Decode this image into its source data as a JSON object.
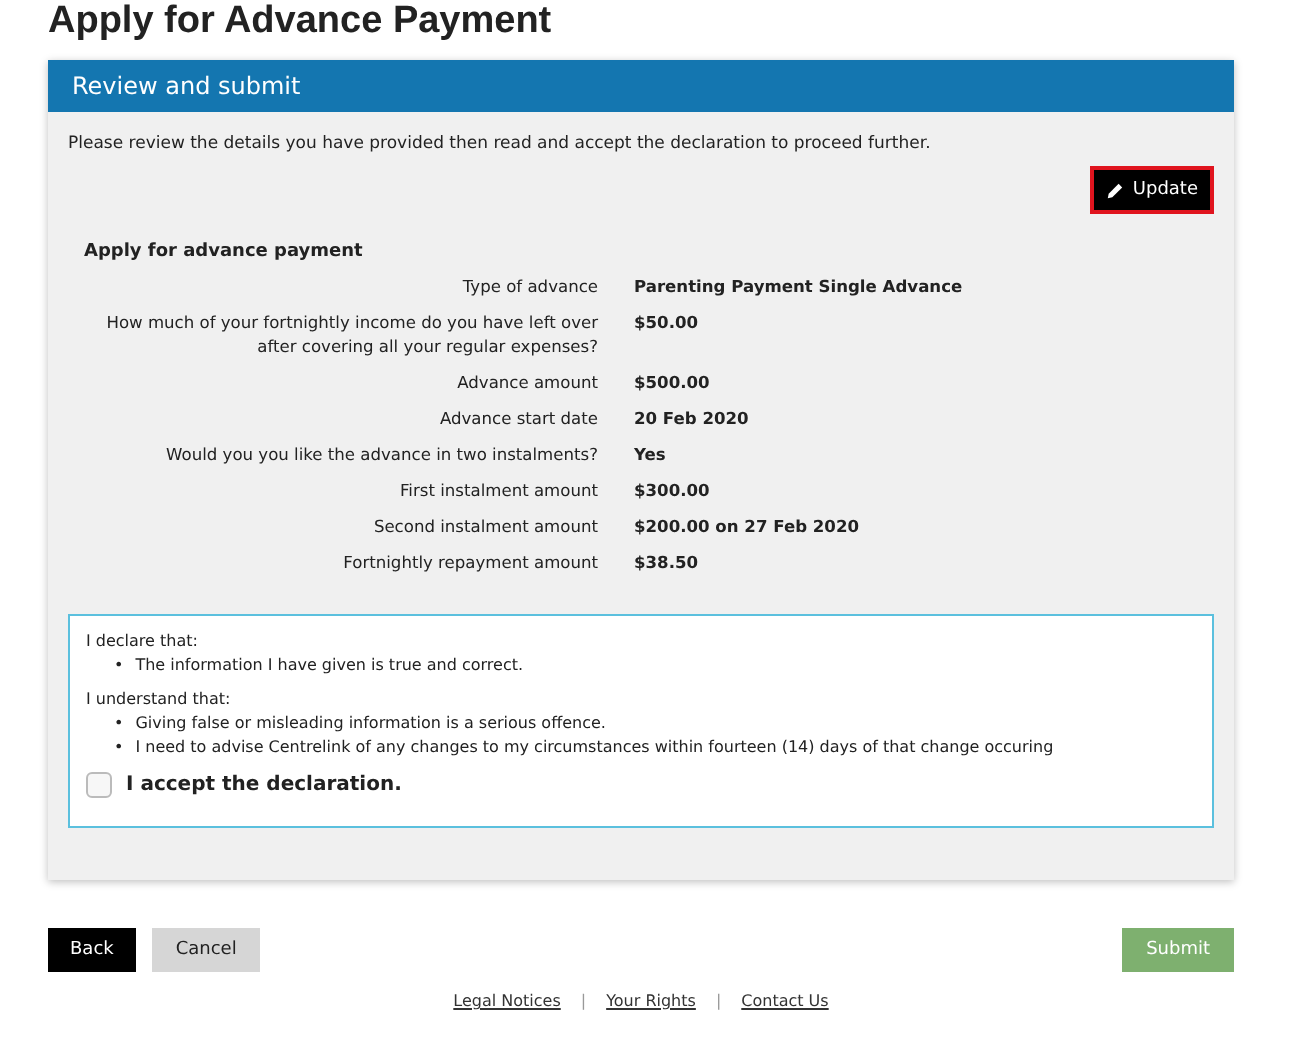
{
  "page_title": "Apply for Advance Payment",
  "panel": {
    "title": "Review and submit",
    "intro": "Please review the details you have provided then read and accept the declaration to proceed further.",
    "update_button": "Update"
  },
  "summary": {
    "title": "Apply for advance payment",
    "rows": [
      {
        "label": "Type of advance",
        "value": "Parenting Payment Single Advance"
      },
      {
        "label": "How much of your fortnightly income do you have left over after covering all your regular expenses?",
        "value": "$50.00"
      },
      {
        "label": "Advance amount",
        "value": "$500.00"
      },
      {
        "label": "Advance start date",
        "value": "20 Feb 2020"
      },
      {
        "label": "Would you you like the advance in two instalments?",
        "value": "Yes"
      },
      {
        "label": "First instalment amount",
        "value": "$300.00"
      },
      {
        "label": "Second instalment amount",
        "value": "$200.00 on 27 Feb 2020"
      },
      {
        "label": "Fortnightly repayment amount",
        "value": "$38.50"
      }
    ]
  },
  "declaration": {
    "bullet": "•",
    "sections": [
      {
        "heading": "I declare that:",
        "items": [
          "The information I have given is true and correct."
        ]
      },
      {
        "heading": "I understand that:",
        "items": [
          "Giving false or misleading information is a serious offence.",
          "I need to advise Centrelink of any changes to my circumstances within fourteen (14) days of that change occuring"
        ]
      }
    ],
    "accept": {
      "label": "I accept the declaration.",
      "checked": false
    }
  },
  "buttons": {
    "back": "Back",
    "cancel": "Cancel",
    "submit": "Submit",
    "submit_disabled": true
  },
  "footer": [
    {
      "kind": "link",
      "text": "Legal Notices"
    },
    {
      "kind": "separator",
      "text": "|"
    },
    {
      "kind": "link",
      "text": "Your Rights"
    },
    {
      "kind": "separator",
      "text": "|"
    },
    {
      "kind": "link",
      "text": "Contact Us"
    }
  ]
}
